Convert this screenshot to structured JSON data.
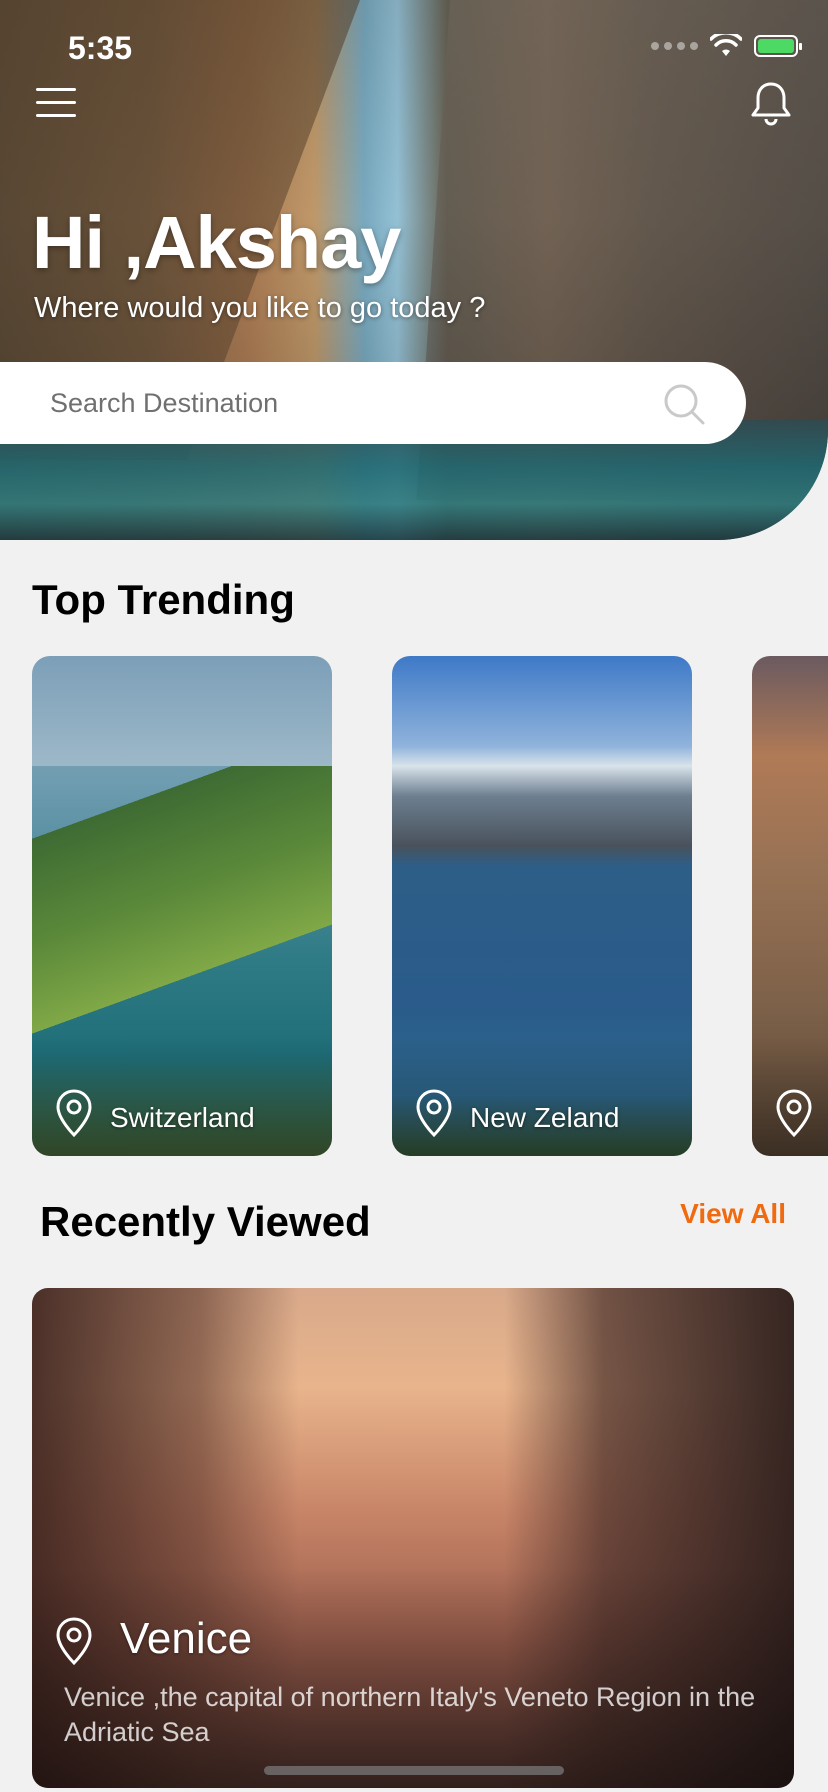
{
  "status_bar": {
    "time": "5:35"
  },
  "header": {
    "greeting": "Hi ,Akshay",
    "subtitle": "Where would you like to go today ?"
  },
  "search": {
    "placeholder": "Search Destination",
    "value": ""
  },
  "top_trending": {
    "title": "Top Trending",
    "items": [
      {
        "label": "Switzerland"
      },
      {
        "label": "New Zeland"
      },
      {
        "label": ""
      }
    ]
  },
  "recently_viewed": {
    "title": "Recently Viewed",
    "view_all_label": "View All",
    "item": {
      "place": "Venice",
      "description": "Venice ,the capital of northern Italy's Veneto Region in the Adriatic Sea"
    }
  },
  "colors": {
    "accent": "#f06a10",
    "background": "#f1f1f1",
    "battery": "#4cd964"
  },
  "icons": [
    "menu-icon",
    "bell-icon",
    "search-icon",
    "location-pin-icon",
    "wifi-icon",
    "battery-icon"
  ]
}
